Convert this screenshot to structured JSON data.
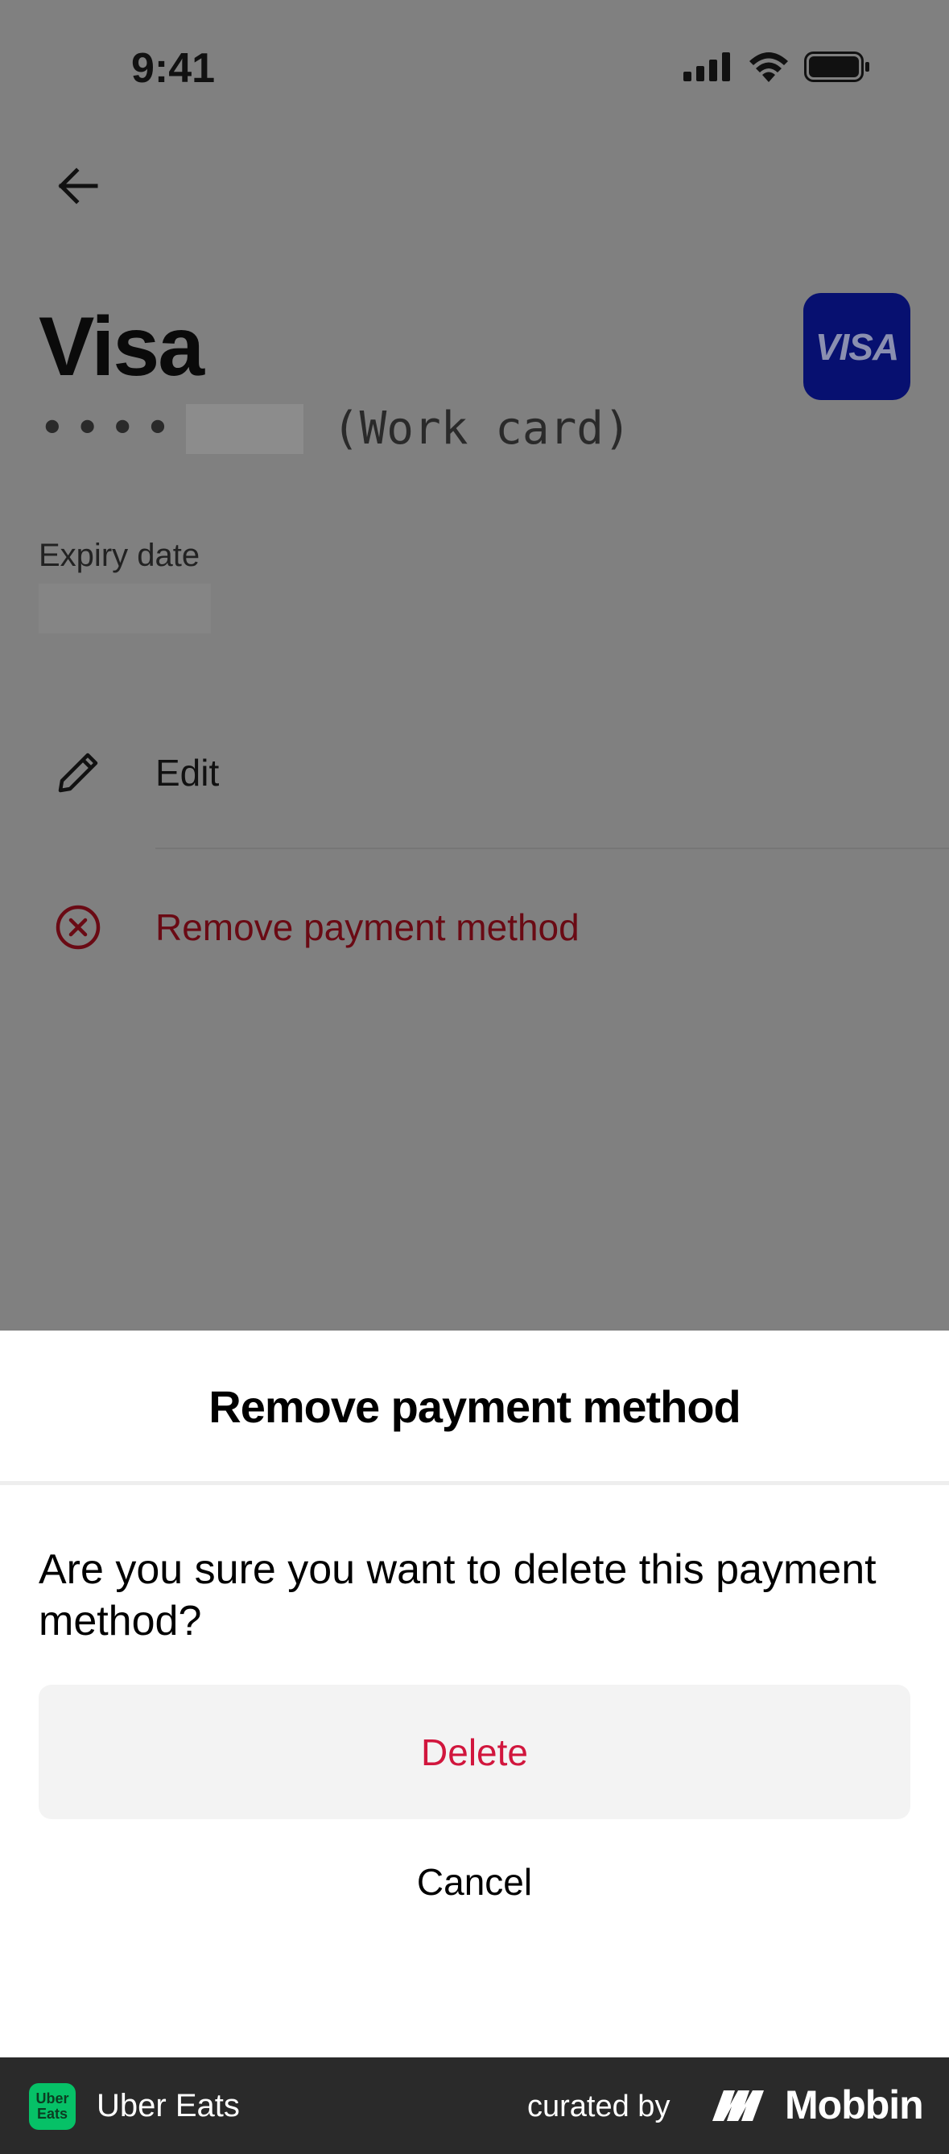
{
  "status_bar": {
    "time": "9:41",
    "signal_icon": "cellular-signal-icon",
    "wifi_icon": "wifi-icon",
    "battery_icon": "battery-icon"
  },
  "header": {
    "back_icon": "arrow-left-icon"
  },
  "card": {
    "brand": "Visa",
    "masked_prefix": "••••",
    "nickname": "(Work card)",
    "logo_text": "VISA",
    "logo_color": "#071070"
  },
  "expiry": {
    "label": "Expiry date"
  },
  "actions": {
    "edit_label": "Edit",
    "edit_icon": "pencil-icon",
    "remove_label": "Remove payment method",
    "remove_icon": "circle-x-icon",
    "remove_color": "#6a0a14"
  },
  "sheet": {
    "title": "Remove payment method",
    "message": "Are you sure you want to delete this payment method?",
    "delete_label": "Delete",
    "cancel_label": "Cancel",
    "delete_color": "#d1163d"
  },
  "footer": {
    "badge_line1": "Uber",
    "badge_line2": "Eats",
    "app_name": "Uber Eats",
    "curated_by": "curated by",
    "brand": "Mobbin",
    "badge_color": "#06c167"
  }
}
